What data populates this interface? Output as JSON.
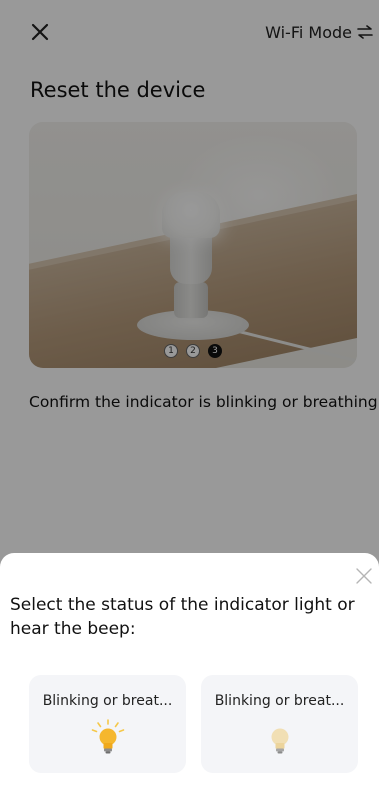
{
  "header": {
    "close_icon": "close-icon",
    "mode_label": "Wi-Fi Mode",
    "mode_icon": "swap-arrows-icon"
  },
  "main": {
    "title": "Reset the device",
    "steps": [
      "1",
      "2",
      "3"
    ],
    "active_step": 3,
    "instruction": "Confirm the indicator is blinking or breathing"
  },
  "sheet": {
    "title": "Select the status of the indicator light or hear the beep:",
    "close_icon": "close-icon",
    "options": [
      {
        "label": "Blinking or breat...",
        "icon": "bulb-blinking-icon"
      },
      {
        "label": "Blinking or breat...",
        "icon": "bulb-breathing-icon"
      }
    ]
  },
  "colors": {
    "overlay": "#000000",
    "sheet_bg": "#ffffff",
    "option_bg": "#f4f5f8",
    "bulb_bright": "#f5b72e",
    "bulb_dim": "#f1dfb4"
  }
}
